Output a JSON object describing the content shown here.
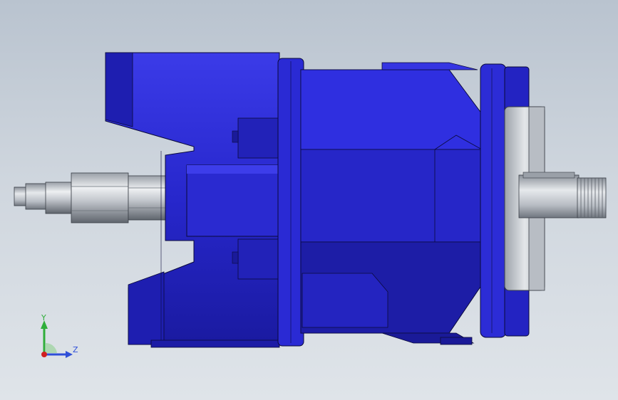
{
  "viewport": {
    "background_top": "#b9c3cf",
    "background_bottom": "#dfe4e9"
  },
  "model": {
    "body_color": "#2b2bd6",
    "body_dark": "#1818a8",
    "body_light": "#4a4af0",
    "body_shadow": "#10106e",
    "metal_color": "#c8ccd2",
    "metal_dark": "#7d838c",
    "outline": "#0a0a3a"
  },
  "triad": {
    "y_label": "Y",
    "z_label": "Z",
    "y_color": "#2fae3a",
    "z_color": "#2f4fd8",
    "origin_color": "#d02020"
  }
}
